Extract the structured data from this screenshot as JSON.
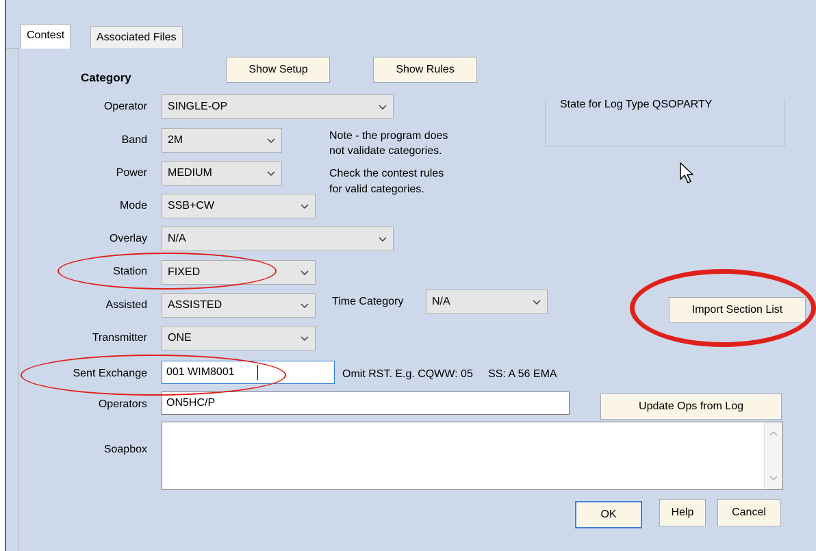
{
  "tabs": [
    {
      "label": "Contest",
      "active": true
    },
    {
      "label": "Associated Files",
      "active": false
    }
  ],
  "category_heading": "Category",
  "buttons": {
    "show_setup": "Show Setup",
    "show_rules": "Show Rules",
    "import_section_list": "Import Section List",
    "update_ops": "Update Ops from Log",
    "ok": "OK",
    "help": "Help",
    "cancel": "Cancel"
  },
  "fields": {
    "operator": {
      "label": "Operator",
      "value": "SINGLE-OP"
    },
    "band": {
      "label": "Band",
      "value": "2M"
    },
    "power": {
      "label": "Power",
      "value": "MEDIUM"
    },
    "mode": {
      "label": "Mode",
      "value": "SSB+CW"
    },
    "overlay": {
      "label": "Overlay",
      "value": "N/A"
    },
    "station": {
      "label": "Station",
      "value": "FIXED"
    },
    "assisted": {
      "label": "Assisted",
      "value": "ASSISTED"
    },
    "transmitter": {
      "label": "Transmitter",
      "value": "ONE"
    },
    "time_category": {
      "label": "Time Category",
      "value": "N/A"
    },
    "sent_exchange": {
      "label": "Sent Exchange",
      "value": "001 WIM8001"
    },
    "operators": {
      "label": "Operators",
      "value": "ON5HC/P"
    },
    "soapbox": {
      "label": "Soapbox",
      "value": ""
    }
  },
  "note": {
    "line1": "Note -  the program does",
    "line2": "not validate categories.",
    "line3": "Check the contest rules",
    "line4": "for valid categories."
  },
  "state_label": "State for Log Type QSOPARTY",
  "exchange_hint": "Omit RST. E.g. CQWW: 05     SS: A 56 EMA",
  "colors": {
    "panel": "#cdd9ea",
    "button": "#fbf5e6",
    "combo": "#e6e6e6",
    "annotation_red": "#e0201a",
    "focus_blue": "#2f7be0"
  },
  "icons": {
    "combo_arrow": "chevron-down-icon",
    "cursor": "mouse-pointer-icon",
    "scroll_up": "chevron-up-icon",
    "scroll_down": "chevron-down-icon"
  }
}
